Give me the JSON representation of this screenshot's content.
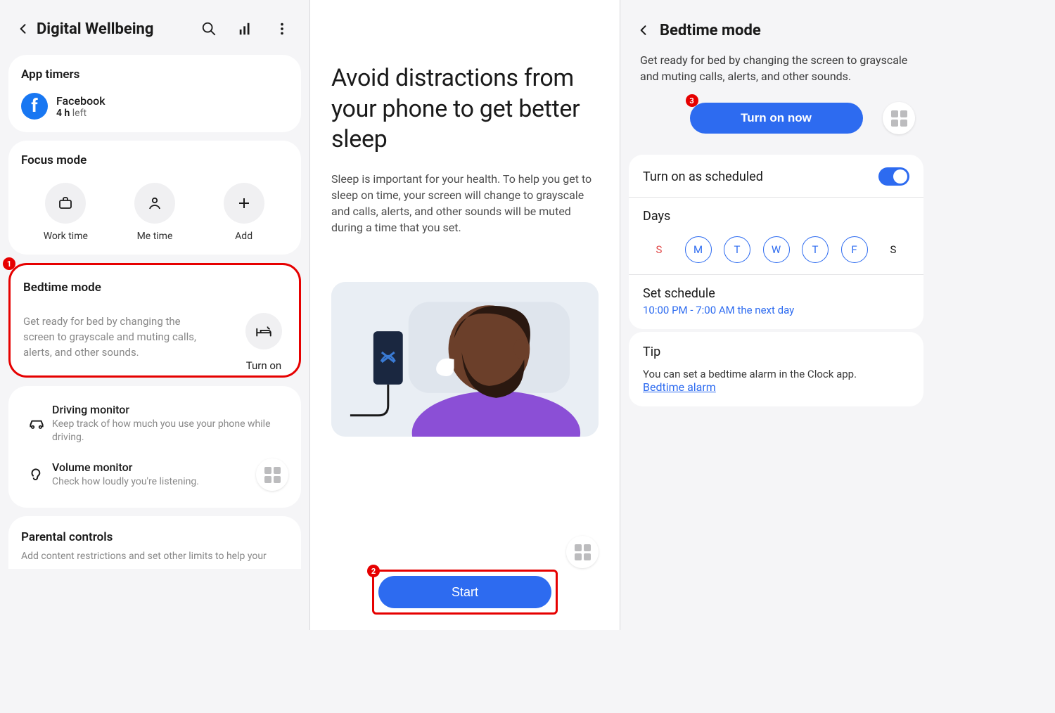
{
  "panel1": {
    "title": "Digital Wellbeing",
    "app_timers": {
      "heading": "App timers",
      "app_name": "Facebook",
      "duration": "4 h",
      "left_label": " left"
    },
    "focus_mode": {
      "heading": "Focus mode",
      "items": [
        "Work time",
        "Me time",
        "Add"
      ]
    },
    "bedtime": {
      "heading": "Bedtime mode",
      "desc": "Get ready for bed by changing the screen to grayscale and muting calls, alerts, and other sounds.",
      "turn_on": "Turn on"
    },
    "driving": {
      "title": "Driving monitor",
      "desc": "Keep track of how much you use your phone while driving."
    },
    "volume": {
      "title": "Volume monitor",
      "desc": "Check how loudly you're listening."
    },
    "parental": {
      "title": "Parental controls",
      "desc": "Add content restrictions and set other limits to help your"
    }
  },
  "panel2": {
    "heading": "Avoid distractions from your phone to get better sleep",
    "body": "Sleep is important for your health. To help you get to sleep on time, your screen will change to grayscale and calls, alerts, and other sounds will be muted during a time that you set.",
    "start": "Start"
  },
  "panel3": {
    "title": "Bedtime mode",
    "subtitle": "Get ready for bed by changing the screen to grayscale and muting calls, alerts, and other sounds.",
    "turn_on_now": "Turn on now",
    "scheduled": "Turn on as scheduled",
    "days_label": "Days",
    "days": [
      "S",
      "M",
      "T",
      "W",
      "T",
      "F",
      "S"
    ],
    "schedule_title": "Set schedule",
    "schedule_value": "10:00 PM - 7:00 AM the next day",
    "tip_label": "Tip",
    "tip_text": "You can set a bedtime alarm in the Clock app.",
    "tip_link": "Bedtime alarm"
  },
  "steps": {
    "s1": "1",
    "s2": "2",
    "s3": "3"
  }
}
